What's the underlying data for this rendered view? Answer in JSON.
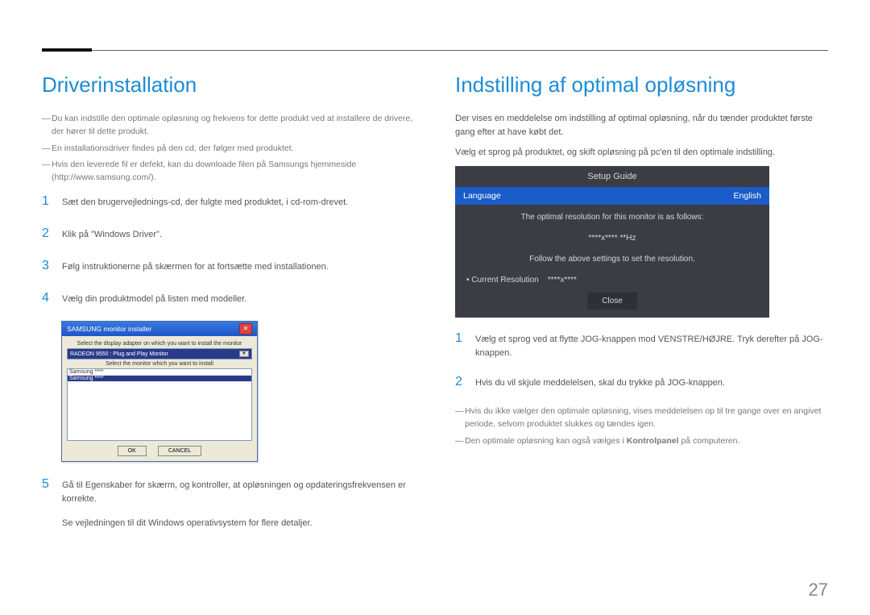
{
  "left": {
    "title": "Driverinstallation",
    "notes": [
      "Du kan indstille den optimale opløsning og frekvens for dette produkt ved at installere de drivere, der hører til dette produkt.",
      "En installationsdriver findes på den cd, der følger med produktet.",
      "Hvis den leverede fil er defekt, kan du downloade filen på Samsungs hjemmeside (http://www.samsung.com/)."
    ],
    "steps": [
      "Sæt den brugervejlednings-cd, der fulgte med produktet, i cd-rom-drevet.",
      "Klik på \"Windows Driver\".",
      "Følg instruktionerne på skærmen for at fortsætte med installationen.",
      "Vælg din produktmodel på listen med modeller."
    ],
    "step5": "Gå til Egenskaber for skærm, og kontroller, at opløsningen og opdateringsfrekvensen er korrekte.",
    "post5": "Se vejledningen til dit Windows operativsystem for flere detaljer.",
    "installer": {
      "titlebar": "SAMSUNG monitor installer",
      "label1": "Select the display adapter on which you want to install the monitor",
      "select_value": "RADEON 9550 : Plug and Play Monitor",
      "label2": "Select the monitor which you want to install",
      "list_item1": "Samsung ****",
      "list_item2": "Samsung ****",
      "btn_ok": "OK",
      "btn_cancel": "CANCEL"
    }
  },
  "right": {
    "title": "Indstilling af optimal opløsning",
    "intro1": "Der vises en meddelelse om indstilling af optimal opløsning, når du tænder produktet første gang efter at have købt det.",
    "intro2": "Vælg et sprog på produktet, og skift opløsning på pc'en til den optimale indstilling.",
    "osd": {
      "title": "Setup Guide",
      "lang_label": "Language",
      "lang_value": "English",
      "line1": "The optimal resolution for this monitor is as follows:",
      "res": "****x**** **Hz",
      "line2": "Follow the above settings to set the resolution.",
      "current_label": "• Current Resolution",
      "current_value": "****x****",
      "close": "Close"
    },
    "steps": [
      "Vælg et sprog ved at flytte JOG-knappen mod VENSTRE/HØJRE. Tryk derefter på JOG-knappen.",
      "Hvis du vil skjule meddelelsen, skal du trykke på JOG-knappen."
    ],
    "notes_after": [
      "Hvis du ikke vælger den optimale opløsning, vises meddelelsen op til tre gange over en angivet periode, selvom produktet slukkes og tændes igen.",
      "Den optimale opløsning kan også vælges i Kontrolpanel på computeren."
    ],
    "bold_word": "Kontrolpanel"
  },
  "page_number": "27",
  "step_nums": [
    "1",
    "2",
    "3",
    "4",
    "5"
  ]
}
